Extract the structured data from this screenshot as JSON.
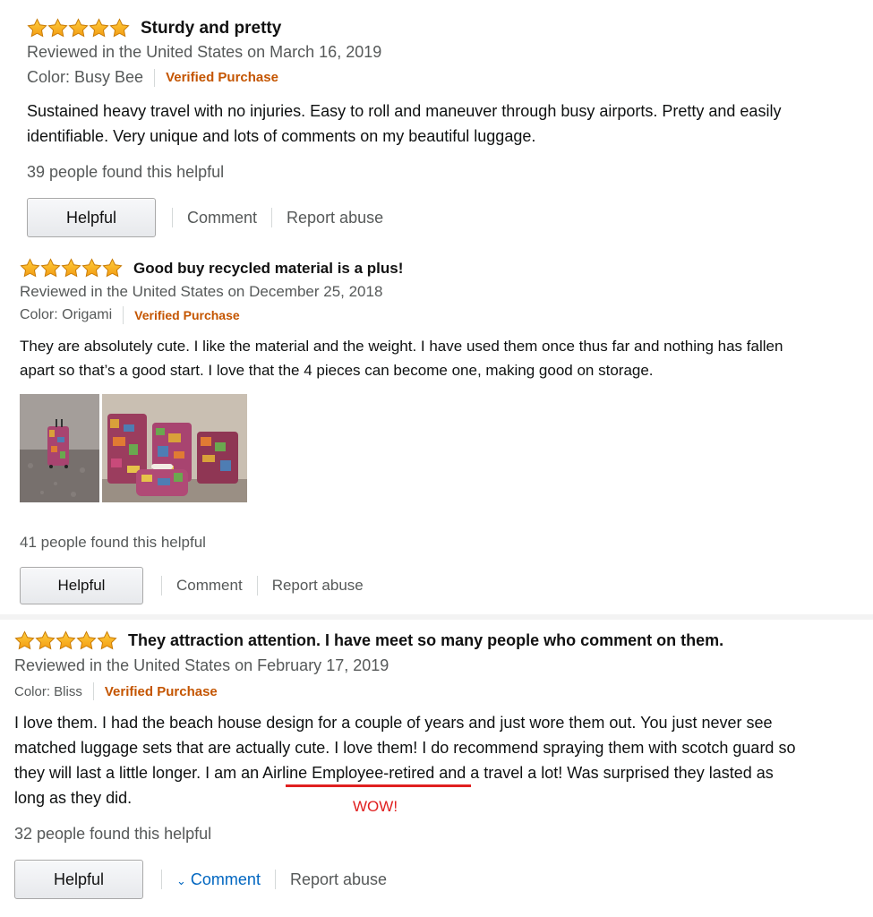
{
  "reviews": [
    {
      "rating": 5,
      "title": "Sturdy and pretty",
      "date_line": "Reviewed in the United States on March 16, 2019",
      "color": "Color: Busy Bee",
      "verified": "Verified Purchase",
      "body_lines": [
        "Sustained heavy travel with no injuries. Easy to roll and maneuver through busy airports. Pretty and easily",
        "identifiable. Very unique and lots of comments on my beautiful luggage."
      ],
      "helpful_count": "39 people found this helpful",
      "helpful_button": "Helpful",
      "comment": "Comment",
      "report": "Report abuse"
    },
    {
      "rating": 5,
      "title": "Good buy recycled material is a plus!",
      "date_line": "Reviewed in the United States on December 25, 2018",
      "color": "Color: Origami",
      "verified": "Verified Purchase",
      "body_lines": [
        "They are absolutely cute. I like the material and the weight. I have used them once thus far and nothing has fallen",
        "apart so that’s a good start. I love that the 4 pieces can become one, making good on storage."
      ],
      "helpful_count": "41 people found this helpful",
      "helpful_button": "Helpful",
      "comment": "Comment",
      "report": "Report abuse"
    },
    {
      "rating": 5,
      "title": "They attraction attention. I have meet so many people who comment on them.",
      "date_line": "Reviewed in the United States on February 17, 2019",
      "color": "Color: Bliss",
      "verified": "Verified Purchase",
      "body_lines": [
        "I love them. I had the beach house design for a couple of years and just wore them out. You just never see",
        "matched luggage sets that are actually cute. I love them! I do recommend spraying them with scotch guard so",
        "they will last a little longer. I am an ",
        "Airline Employee-retired",
        " and a travel a lot! Was surprised they lasted as",
        "long as they did."
      ],
      "annotation": "WOW!",
      "helpful_count": "32 people found this helpful",
      "helpful_button": "Helpful",
      "comment": "Comment",
      "report": "Report abuse"
    }
  ],
  "colors": {
    "star": "#f6a623",
    "verified": "#c45500",
    "link": "#0066c0",
    "annotation": "#e02020"
  }
}
